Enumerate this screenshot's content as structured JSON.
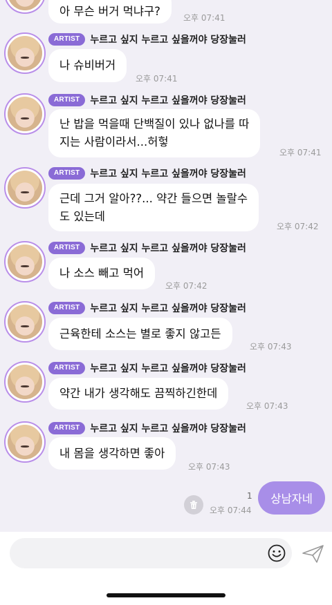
{
  "sender": {
    "badge": "ARTIST",
    "name": "누르고 싶지 누르고 싶을꺼야 당장눌러"
  },
  "messages": [
    {
      "lines": [
        "아 무슨 버거 먹냐구?"
      ],
      "time": "오후 07:41"
    },
    {
      "lines": [
        "나 슈비버거"
      ],
      "time": "오후 07:41"
    },
    {
      "lines": [
        "난 밥을 먹을때 단백질이 있나 없나를 따",
        "지는 사람이라서...허헣"
      ],
      "time": "오후 07:41"
    },
    {
      "lines": [
        "근데 그거 알아??... 약간 들으면 놀랄수",
        "도 있는데"
      ],
      "time": "오후 07:42"
    },
    {
      "lines": [
        "나 소스 빼고 먹어"
      ],
      "time": "오후 07:42"
    },
    {
      "lines": [
        "근육한테 소스는 별로 좋지 않고든"
      ],
      "time": "오후 07:43"
    },
    {
      "lines": [
        "약간 내가 생각해도 끔찍하긴한데"
      ],
      "time": "오후 07:43"
    },
    {
      "lines": [
        "내 몸을 생각하면 좋아"
      ],
      "time": "오후 07:43"
    }
  ],
  "sent": {
    "text": "상남자네",
    "read_count": "1",
    "time": "오후 07:44"
  },
  "composer": {
    "placeholder": ""
  },
  "icons": {
    "delete": "trash-icon",
    "emoji": "emoji-icon",
    "send": "paper-plane-icon"
  },
  "colors": {
    "badge": "#8a6bd6",
    "sent_bubble": "#a88ee8",
    "chat_bg": "#f1eff6",
    "avatar_ring": "#b98ee9"
  }
}
